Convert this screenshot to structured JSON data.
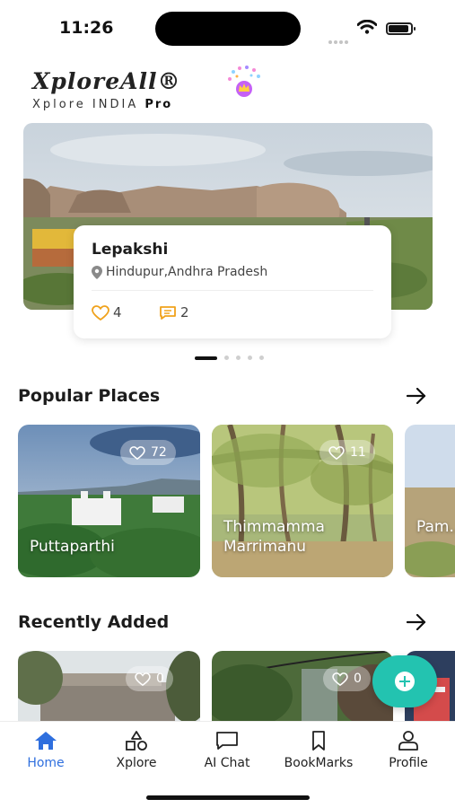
{
  "status_bar": {
    "time": "11:26"
  },
  "brand": {
    "title": "XploreAll®",
    "subtitle": "Xplore INDIA",
    "tier": "Pro"
  },
  "featured": {
    "title": "Lepakshi",
    "location": "Hindupur,Andhra Pradesh",
    "likes": "4",
    "comments": "2",
    "pages": 5,
    "active_page": 1
  },
  "popular": {
    "title": "Popular Places",
    "items": [
      {
        "name": "Puttaparthi",
        "likes": "72"
      },
      {
        "name": "Thimmamma Marrimanu",
        "likes": "11"
      },
      {
        "name": "Pam... Temp...",
        "likes": ""
      }
    ]
  },
  "recent": {
    "title": "Recently Added",
    "items": [
      {
        "name": "",
        "likes": "0"
      },
      {
        "name": "",
        "likes": "0"
      }
    ]
  },
  "nav": {
    "items": [
      {
        "label": "Home",
        "icon": "home-icon",
        "active": true
      },
      {
        "label": "Xplore",
        "icon": "shapes-icon",
        "active": false
      },
      {
        "label": "AI Chat",
        "icon": "chat-icon",
        "active": false
      },
      {
        "label": "BookMarks",
        "icon": "bookmark-icon",
        "active": false
      },
      {
        "label": "Profile",
        "icon": "person-icon",
        "active": false
      }
    ]
  },
  "colors": {
    "accent": "#2f6fde",
    "fab": "#23c3b0",
    "stat": "#f0a21c"
  }
}
